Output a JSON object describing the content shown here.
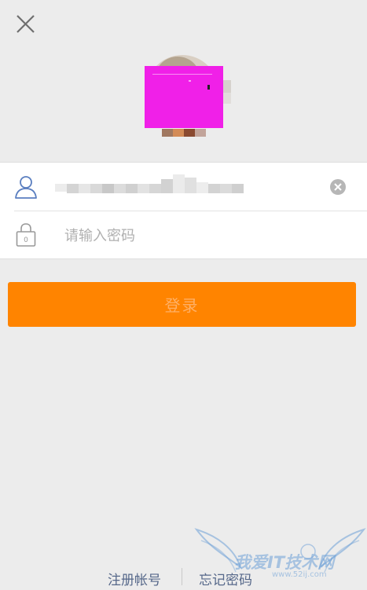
{
  "header": {
    "close_icon": "close-x-icon"
  },
  "avatar": {
    "icon": "user-avatar",
    "mask_color": "#f020e8"
  },
  "form": {
    "username": {
      "icon": "user-outline-icon",
      "value": "",
      "clear_icon": "clear-circle-icon"
    },
    "password": {
      "icon": "lock-outline-icon",
      "placeholder": "请输入密码"
    }
  },
  "login_button": {
    "label": "登录",
    "color": "#ff8400"
  },
  "bottom_links": {
    "register": "注册帐号",
    "forgot": "忘记密码"
  },
  "watermark": {
    "text": "我爱IT技术网",
    "url": "www.52ij.com"
  },
  "colors": {
    "background": "#ececec",
    "accent": "#ff8400",
    "icon_blue": "#5b7fc0",
    "link": "#56688a"
  }
}
